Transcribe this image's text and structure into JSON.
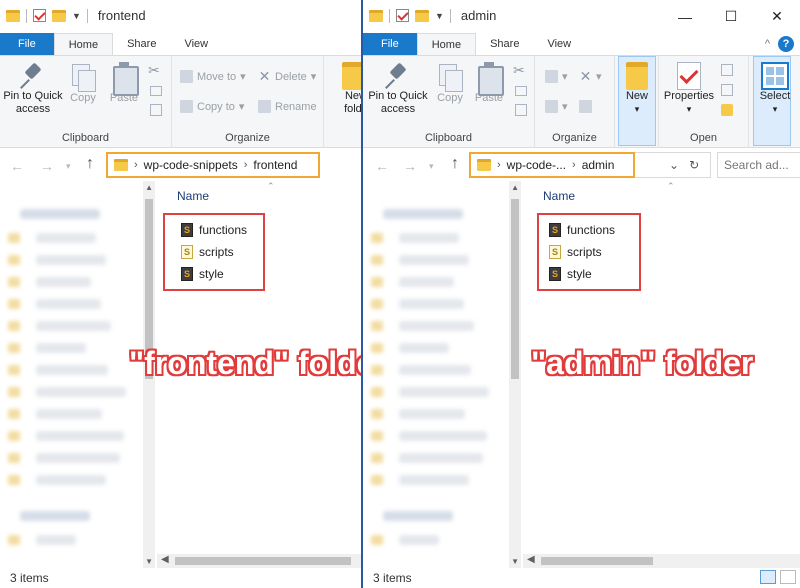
{
  "left": {
    "title": "frontend",
    "tabs": {
      "file": "File",
      "home": "Home",
      "share": "Share",
      "view": "View"
    },
    "ribbon": {
      "pin": "Pin to Quick access",
      "copy": "Copy",
      "paste": "Paste",
      "clipboard": "Clipboard",
      "move_to": "Move to",
      "copy_to": "Copy to",
      "delete": "Delete",
      "rename": "Rename",
      "organize": "Organize",
      "new": "New folde"
    },
    "breadcrumb": [
      "wp-code-snippets",
      "frontend"
    ],
    "column_name": "Name",
    "files": [
      "functions",
      "scripts",
      "style"
    ],
    "label": "\"frontend\" folder",
    "status": "3 items"
  },
  "right": {
    "title": "admin",
    "tabs": {
      "file": "File",
      "home": "Home",
      "share": "Share",
      "view": "View"
    },
    "ribbon": {
      "pin": "Pin to Quick access",
      "copy": "Copy",
      "paste": "Paste",
      "clipboard": "Clipboard",
      "organize": "Organize",
      "new": "New",
      "properties": "Properties",
      "open": "Open",
      "select": "Select"
    },
    "breadcrumb": [
      "wp-code-...",
      "admin"
    ],
    "search_placeholder": "Search ad...",
    "column_name": "Name",
    "files": [
      "functions",
      "scripts",
      "style"
    ],
    "label": "\"admin\" folder",
    "status": "3 items"
  },
  "colors": {
    "accent": "#1979ca",
    "highlight_orange": "#f0a830",
    "highlight_red": "#e04040"
  }
}
